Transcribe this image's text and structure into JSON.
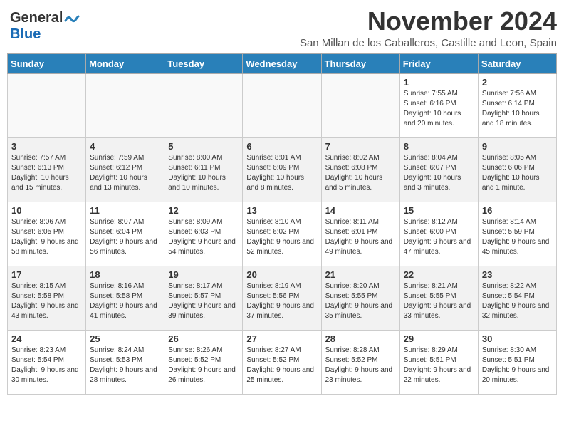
{
  "header": {
    "logo_general": "General",
    "logo_blue": "Blue",
    "month_title": "November 2024",
    "location": "San Millan de los Caballeros, Castille and Leon, Spain"
  },
  "weekdays": [
    "Sunday",
    "Monday",
    "Tuesday",
    "Wednesday",
    "Thursday",
    "Friday",
    "Saturday"
  ],
  "weeks": [
    [
      {
        "day": "",
        "info": ""
      },
      {
        "day": "",
        "info": ""
      },
      {
        "day": "",
        "info": ""
      },
      {
        "day": "",
        "info": ""
      },
      {
        "day": "",
        "info": ""
      },
      {
        "day": "1",
        "info": "Sunrise: 7:55 AM\nSunset: 6:16 PM\nDaylight: 10 hours and 20 minutes."
      },
      {
        "day": "2",
        "info": "Sunrise: 7:56 AM\nSunset: 6:14 PM\nDaylight: 10 hours and 18 minutes."
      }
    ],
    [
      {
        "day": "3",
        "info": "Sunrise: 7:57 AM\nSunset: 6:13 PM\nDaylight: 10 hours and 15 minutes."
      },
      {
        "day": "4",
        "info": "Sunrise: 7:59 AM\nSunset: 6:12 PM\nDaylight: 10 hours and 13 minutes."
      },
      {
        "day": "5",
        "info": "Sunrise: 8:00 AM\nSunset: 6:11 PM\nDaylight: 10 hours and 10 minutes."
      },
      {
        "day": "6",
        "info": "Sunrise: 8:01 AM\nSunset: 6:09 PM\nDaylight: 10 hours and 8 minutes."
      },
      {
        "day": "7",
        "info": "Sunrise: 8:02 AM\nSunset: 6:08 PM\nDaylight: 10 hours and 5 minutes."
      },
      {
        "day": "8",
        "info": "Sunrise: 8:04 AM\nSunset: 6:07 PM\nDaylight: 10 hours and 3 minutes."
      },
      {
        "day": "9",
        "info": "Sunrise: 8:05 AM\nSunset: 6:06 PM\nDaylight: 10 hours and 1 minute."
      }
    ],
    [
      {
        "day": "10",
        "info": "Sunrise: 8:06 AM\nSunset: 6:05 PM\nDaylight: 9 hours and 58 minutes."
      },
      {
        "day": "11",
        "info": "Sunrise: 8:07 AM\nSunset: 6:04 PM\nDaylight: 9 hours and 56 minutes."
      },
      {
        "day": "12",
        "info": "Sunrise: 8:09 AM\nSunset: 6:03 PM\nDaylight: 9 hours and 54 minutes."
      },
      {
        "day": "13",
        "info": "Sunrise: 8:10 AM\nSunset: 6:02 PM\nDaylight: 9 hours and 52 minutes."
      },
      {
        "day": "14",
        "info": "Sunrise: 8:11 AM\nSunset: 6:01 PM\nDaylight: 9 hours and 49 minutes."
      },
      {
        "day": "15",
        "info": "Sunrise: 8:12 AM\nSunset: 6:00 PM\nDaylight: 9 hours and 47 minutes."
      },
      {
        "day": "16",
        "info": "Sunrise: 8:14 AM\nSunset: 5:59 PM\nDaylight: 9 hours and 45 minutes."
      }
    ],
    [
      {
        "day": "17",
        "info": "Sunrise: 8:15 AM\nSunset: 5:58 PM\nDaylight: 9 hours and 43 minutes."
      },
      {
        "day": "18",
        "info": "Sunrise: 8:16 AM\nSunset: 5:58 PM\nDaylight: 9 hours and 41 minutes."
      },
      {
        "day": "19",
        "info": "Sunrise: 8:17 AM\nSunset: 5:57 PM\nDaylight: 9 hours and 39 minutes."
      },
      {
        "day": "20",
        "info": "Sunrise: 8:19 AM\nSunset: 5:56 PM\nDaylight: 9 hours and 37 minutes."
      },
      {
        "day": "21",
        "info": "Sunrise: 8:20 AM\nSunset: 5:55 PM\nDaylight: 9 hours and 35 minutes."
      },
      {
        "day": "22",
        "info": "Sunrise: 8:21 AM\nSunset: 5:55 PM\nDaylight: 9 hours and 33 minutes."
      },
      {
        "day": "23",
        "info": "Sunrise: 8:22 AM\nSunset: 5:54 PM\nDaylight: 9 hours and 32 minutes."
      }
    ],
    [
      {
        "day": "24",
        "info": "Sunrise: 8:23 AM\nSunset: 5:54 PM\nDaylight: 9 hours and 30 minutes."
      },
      {
        "day": "25",
        "info": "Sunrise: 8:24 AM\nSunset: 5:53 PM\nDaylight: 9 hours and 28 minutes."
      },
      {
        "day": "26",
        "info": "Sunrise: 8:26 AM\nSunset: 5:52 PM\nDaylight: 9 hours and 26 minutes."
      },
      {
        "day": "27",
        "info": "Sunrise: 8:27 AM\nSunset: 5:52 PM\nDaylight: 9 hours and 25 minutes."
      },
      {
        "day": "28",
        "info": "Sunrise: 8:28 AM\nSunset: 5:52 PM\nDaylight: 9 hours and 23 minutes."
      },
      {
        "day": "29",
        "info": "Sunrise: 8:29 AM\nSunset: 5:51 PM\nDaylight: 9 hours and 22 minutes."
      },
      {
        "day": "30",
        "info": "Sunrise: 8:30 AM\nSunset: 5:51 PM\nDaylight: 9 hours and 20 minutes."
      }
    ]
  ]
}
